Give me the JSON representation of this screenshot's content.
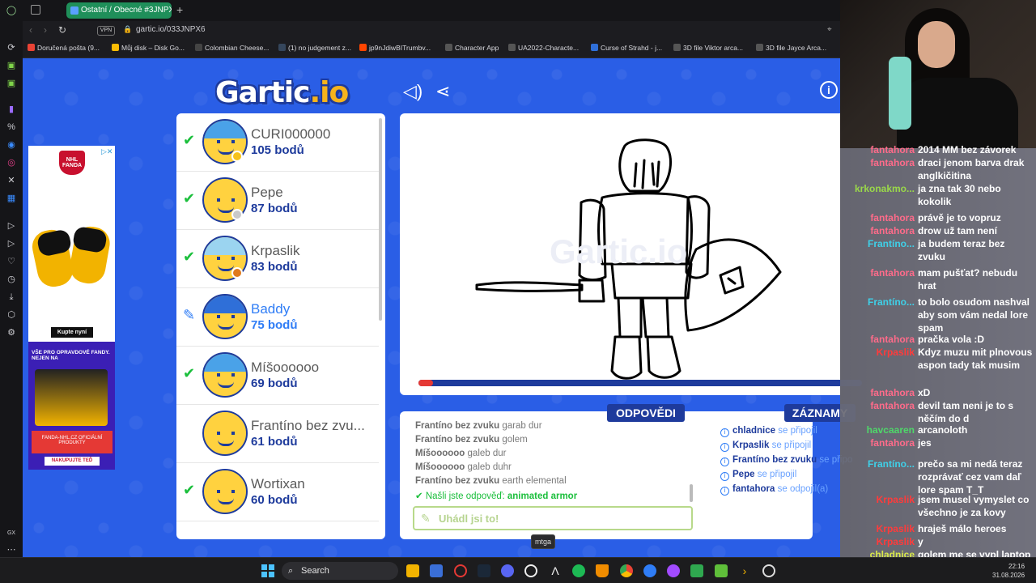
{
  "browser": {
    "tab_title": "Ostatní / Obecné #3JNPX6",
    "url": "gartic.io/033JNPX6",
    "vpn_label": "VPN",
    "bookmarks": [
      "Doručená pošta (9...",
      "Můj disk – Disk Go...",
      "Colombian Cheese...",
      "(1) no judgement z...",
      "jp9nJdiwBITrumbv...",
      "Character App",
      "UA2022-Characte...",
      "Curse of Strahd - j...",
      "3D file Viktor arca...",
      "3D file Jayce Arca..."
    ]
  },
  "game": {
    "logo_main": "Gartic",
    "logo_suffix": ".io",
    "players": [
      {
        "name": "CURI000000",
        "points": "105 bodů",
        "status": "guessed",
        "badge": "#f6c21c",
        "hair": "#4aa2e8"
      },
      {
        "name": "Pepe",
        "points": "87 bodů",
        "status": "guessed",
        "badge": "#c9c9c9",
        "hair": "#ffd23f"
      },
      {
        "name": "Krpaslik",
        "points": "83 bodů",
        "status": "guessed",
        "badge": "#e07a1c",
        "hair": "#9bd4f0"
      },
      {
        "name": "Baddy",
        "points": "75 bodů",
        "status": "drawing",
        "badge": "",
        "hair": "#2f6fd8"
      },
      {
        "name": "Míšoooooo",
        "points": "69 bodů",
        "status": "guessed",
        "badge": "",
        "hair": "#4aa2e8"
      },
      {
        "name": "Frantíno bez zvu...",
        "points": "61 bodů",
        "status": "none",
        "badge": "",
        "hair": "#ffd23f"
      },
      {
        "name": "Wortixan",
        "points": "60 bodů",
        "status": "guessed",
        "badge": "",
        "hair": "#ffd23f"
      }
    ],
    "answers_tab": "ODPOVĚDI",
    "records_tab": "ZÁZNAMY",
    "answer_lines": [
      {
        "user": "Frantíno bez zvuku",
        "text": "garab dur"
      },
      {
        "user": "Frantíno bez zvuku",
        "text": "golem"
      },
      {
        "user": "Míšoooooo",
        "text": "galeb dur"
      },
      {
        "user": "Míšoooooo",
        "text": "galeb duhr"
      },
      {
        "user": "Frantíno bez zvuku",
        "text": "earth elemental"
      }
    ],
    "found_prefix": "Našli jste odpověď:",
    "found_answer": "animated armor",
    "guess_placeholder": "Uhádl jsi to!",
    "log_lines": [
      {
        "user": "chladnice",
        "text": "se připojil"
      },
      {
        "user": "Krpaslik",
        "text": "se připojil"
      },
      {
        "user": "Frantíno bez zvuku",
        "text": "se připo"
      },
      {
        "user": "Pepe",
        "text": "se připojil"
      },
      {
        "user": "fantahora",
        "text": "se odpojil(a)"
      }
    ]
  },
  "ad": {
    "brand": "NHL FANDA",
    "cta": "Kupte nyní",
    "promo": "VŠE PRO OPRAVDOVÉ FANDY. NEJEN NA",
    "shop": "FANDA-NHL.CZ OFICIÁLNÍ PRODUKTY",
    "cta2": "NAKUPUJTE TEĎ"
  },
  "chat": [
    {
      "user": "fantahora",
      "color": "#ff6b8a",
      "msg": "2014 MM bez závorek"
    },
    {
      "user": "fantahora",
      "color": "#ff6b8a",
      "msg": "draci jenom barva drak anglkičitina"
    },
    {
      "user": "krkonakmo...",
      "color": "#9ad84a",
      "msg": "ja zna tak 30 nebo kokolik"
    },
    {
      "user": "fantahora",
      "color": "#ff6b8a",
      "msg": "právě je to vopruz"
    },
    {
      "user": "fantahora",
      "color": "#ff6b8a",
      "msg": "drow už tam není"
    },
    {
      "user": "Frantíno...",
      "color": "#3fd0e8",
      "msg": "ja budem teraz bez zvuku"
    },
    {
      "user": "fantahora",
      "color": "#ff6b8a",
      "msg": "mam pušťat? nebudu hrat"
    },
    {
      "user": "Frantíno...",
      "color": "#3fd0e8",
      "msg": "to bolo osudom nashval aby som vám nedal lore spam"
    },
    {
      "user": "fantahora",
      "color": "#ff6b8a",
      "msg": "pračka vola :D"
    },
    {
      "user": "Krpaslik",
      "color": "#ff3b3b",
      "msg": "Kdyz muzu mit plnovous aspon tady tak musim"
    },
    {
      "user": "fantahora",
      "color": "#ff6b8a",
      "msg": "xD"
    },
    {
      "user": "fantahora",
      "color": "#ff6b8a",
      "msg": "devil tam neni je to s něčím do d"
    },
    {
      "user": "havcaaren",
      "color": "#4fd86a",
      "msg": "arcanoloth"
    },
    {
      "user": "fantahora",
      "color": "#ff6b8a",
      "msg": "jes"
    },
    {
      "user": "Frantíno...",
      "color": "#3fd0e8",
      "msg": "prečo sa mi nedá teraz rozprávať cez vam daľ lore spam T_T"
    },
    {
      "user": "Krpaslik",
      "color": "#ff3b3b",
      "msg": "jsem musel vymyslet co všechno je za kovy"
    },
    {
      "user": "Krpaslik",
      "color": "#ff3b3b",
      "msg": "hraješ málo heroes"
    },
    {
      "user": "Krpaslik",
      "color": "#ff3b3b",
      "msg": "y"
    },
    {
      "user": "chladnice",
      "color": "#d8e84a",
      "msg": "golem me se vypl laptop"
    }
  ],
  "taskbar": {
    "search_label": "Search",
    "tooltip": "mtga",
    "time": "22:16",
    "date": "31.08.2026"
  }
}
